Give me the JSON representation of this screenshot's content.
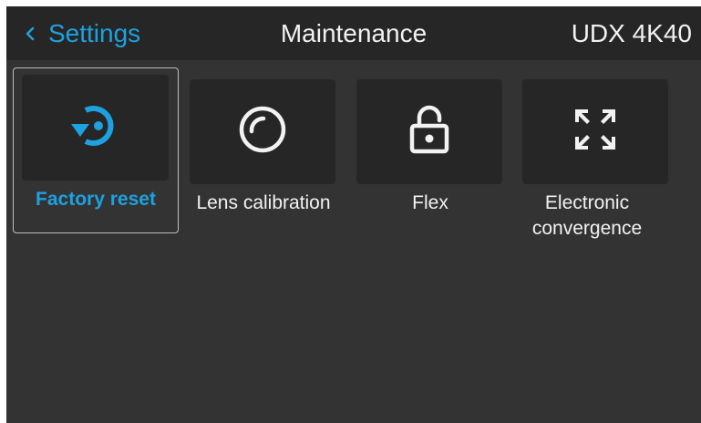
{
  "header": {
    "back_label": "Settings",
    "title": "Maintenance",
    "model": "UDX 4K40"
  },
  "tiles": [
    {
      "label": "Factory reset",
      "icon": "factory-reset-icon",
      "selected": true
    },
    {
      "label": "Lens calibration",
      "icon": "lens-icon",
      "selected": false
    },
    {
      "label": "Flex",
      "icon": "unlock-icon",
      "selected": false
    },
    {
      "label": "Electronic convergence",
      "icon": "convergence-icon",
      "selected": false
    }
  ],
  "colors": {
    "accent": "#1da1e0",
    "background": "#333333",
    "header": "#262626",
    "tile": "#262626",
    "text": "#f2f2f2"
  }
}
